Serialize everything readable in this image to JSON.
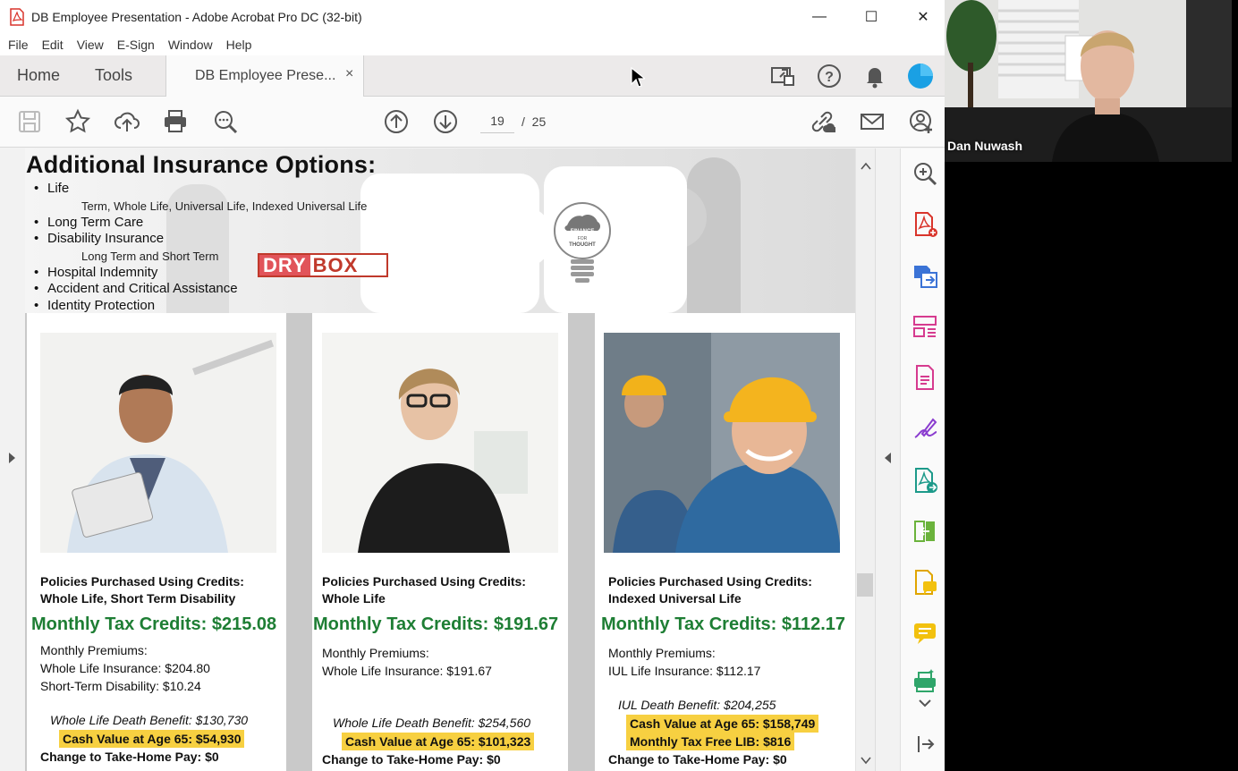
{
  "window": {
    "title": "DB Employee Presentation - Adobe Acrobat Pro DC (32-bit)",
    "minimize": "—",
    "maximize": "☐",
    "close": "✕"
  },
  "menu": [
    "File",
    "Edit",
    "View",
    "E-Sign",
    "Window",
    "Help"
  ],
  "tabs": {
    "home": "Home",
    "tools": "Tools",
    "document": "DB Employee Prese...",
    "close": "×"
  },
  "toolbar": {
    "page_current": "19",
    "page_sep": "/",
    "page_total": "25"
  },
  "document": {
    "heading": "Additional Insurance Options:",
    "bullets": [
      {
        "label": "Life"
      },
      {
        "sub": "Term, Whole Life, Universal Life, Indexed Universal Life"
      },
      {
        "label": "Long Term Care"
      },
      {
        "label": "Disability Insurance"
      },
      {
        "sub": "Long Term and Short Term"
      },
      {
        "label": "Hospital Indemnity"
      },
      {
        "label": "Accident and Critical Assistance"
      },
      {
        "label": "Identity Protection"
      }
    ],
    "logo_dry": "DRY",
    "logo_box": "BOX",
    "bulb_text": [
      "FINANCE",
      "FOR",
      "THOUGHT"
    ],
    "cards": [
      {
        "policy_line1": "Policies Purchased Using Credits:",
        "policy_line2": "Whole Life, Short Term Disability",
        "credits": "Monthly Tax Credits: $215.08",
        "premiums_title": "Monthly Premiums:",
        "premium1": "Whole Life Insurance: $204.80",
        "premium2": "Short-Term Disability: $10.24",
        "death": "Whole Life Death Benefit: $130,730",
        "highlight1": "Cash Value at Age 65: $54,930",
        "takehome": "Change to Take-Home Pay: $0"
      },
      {
        "policy_line1": "Policies Purchased Using Credits:",
        "policy_line2": "Whole Life",
        "credits": "Monthly Tax Credits: $191.67",
        "premiums_title": "Monthly Premiums:",
        "premium1": "Whole Life Insurance: $191.67",
        "death": "Whole Life Death Benefit: $254,560",
        "highlight1": "Cash Value at Age 65: $101,323",
        "takehome": "Change to Take-Home Pay: $0"
      },
      {
        "policy_line1": "Policies Purchased Using Credits:",
        "policy_line2": "Indexed Universal Life",
        "credits": "Monthly Tax Credits: $112.17",
        "premiums_title": "Monthly Premiums:",
        "premium1": "IUL Life Insurance: $112.17",
        "death": "IUL Death Benefit: $204,255",
        "highlight1": "Cash Value at Age 65: $158,749",
        "highlight2": "Monthly Tax Free LIB: $816",
        "takehome": "Change to Take-Home Pay: $0"
      }
    ]
  },
  "webcam": {
    "name": "Dan Nuwash"
  },
  "colors": {
    "acrobat_red": "#d9342b",
    "credits_green": "#1e7e34",
    "highlight_yellow": "#f7d041",
    "tool_pink": "#d63b8f",
    "tool_blue": "#3b73d6"
  }
}
